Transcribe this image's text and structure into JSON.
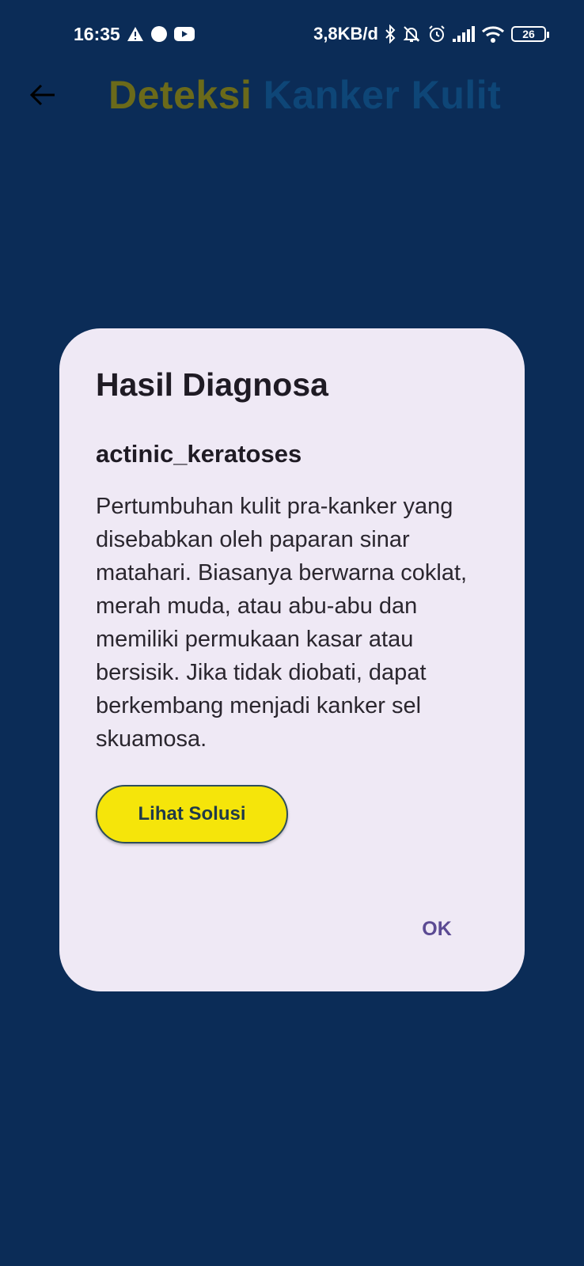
{
  "status_bar": {
    "time": "16:35",
    "network_speed": "3,8KB/d",
    "battery_level": "26",
    "icons": [
      "warning-icon",
      "circle-icon",
      "youtube-icon",
      "bluetooth-icon",
      "bell-off-icon",
      "alarm-icon",
      "signal-icon",
      "wifi-icon",
      "battery-icon"
    ]
  },
  "app_bar": {
    "title_part1": "Deteksi",
    "title_part2": "Kanker Kulit",
    "title_part1_color": "#6b6a1a",
    "title_part2_color": "#0e4677",
    "back_icon": "arrow-back-icon"
  },
  "dialog": {
    "title": "Hasil Diagnosa",
    "diagnosis": "actinic_keratoses",
    "description": "Pertumbuhan kulit pra-kanker yang disebabkan oleh paparan sinar matahari. Biasanya berwarna coklat, merah muda, atau abu-abu dan memiliki permukaan kasar atau bersisik. Jika tidak diobati, dapat berkembang menjadi kanker sel skuamosa.",
    "solution_button": "Lihat Solusi",
    "ok_button": "OK"
  },
  "colors": {
    "background": "#0b2c57",
    "dialog_background": "#efe9f5",
    "button_yellow": "#f5e50a",
    "ok_text": "#5b4a93"
  }
}
